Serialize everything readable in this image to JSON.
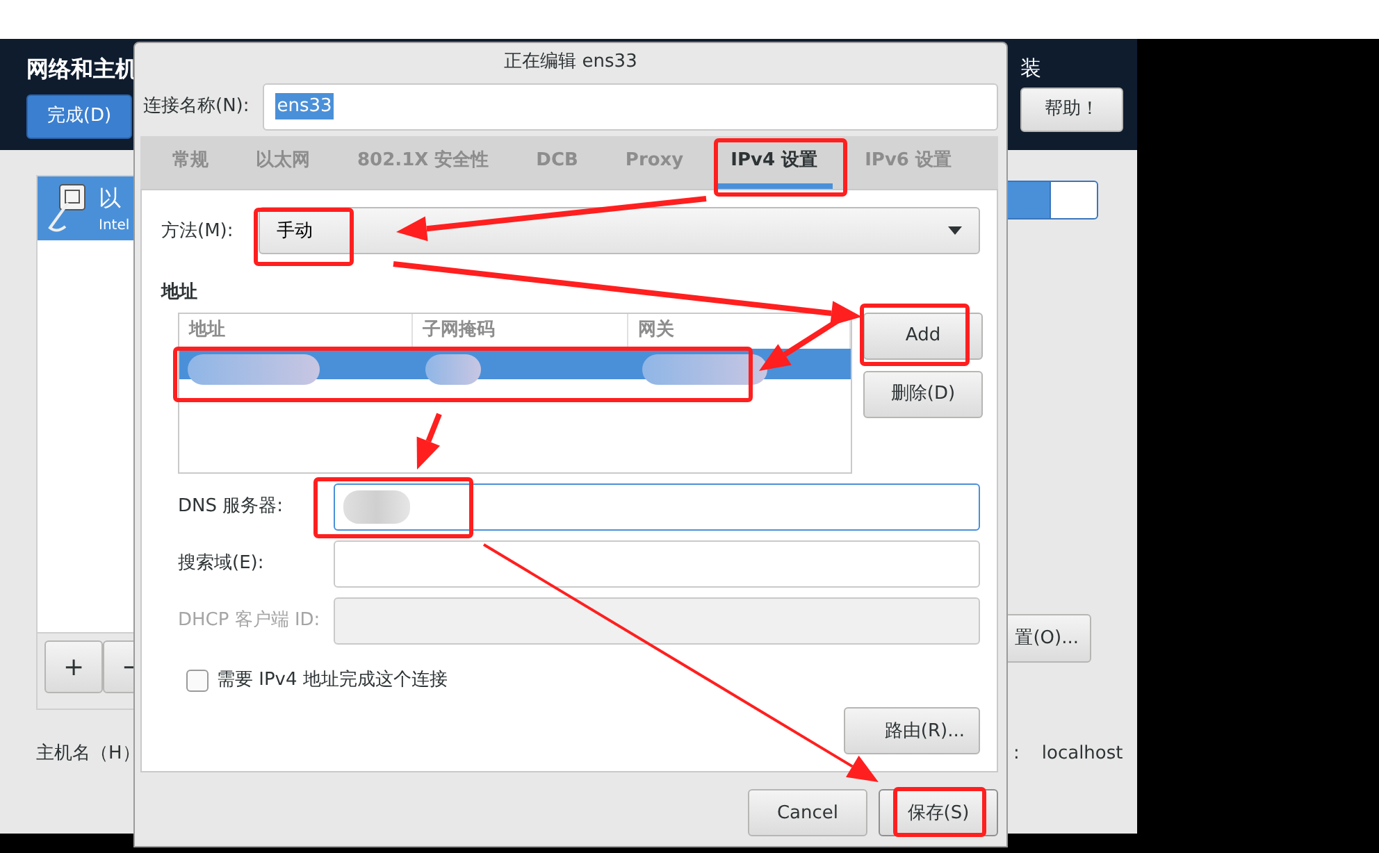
{
  "background_app": {
    "title": "网络和主机",
    "done_button": "完成(D)",
    "header_text": "装",
    "help_button": "帮助！",
    "connections": [
      {
        "name": "以",
        "subtitle": "Intel",
        "selected": true
      }
    ],
    "add_button": "+",
    "remove_button": "−",
    "toggle": {
      "on": true
    },
    "configure_button": "置(O)...",
    "hostname_label": "主机名（H）",
    "hostname_colon": ":",
    "hostname_value": "localhost"
  },
  "dialog": {
    "title": "正在编辑 ens33",
    "connection_name_label": "连接名称(N):",
    "connection_name": "ens33",
    "tabs": [
      {
        "label": "常规",
        "selected": false
      },
      {
        "label": "以太网",
        "selected": false
      },
      {
        "label": "802.1X 安全性",
        "selected": false
      },
      {
        "label": "DCB",
        "selected": false
      },
      {
        "label": "Proxy",
        "selected": false
      },
      {
        "label": "IPv4 设置",
        "selected": true
      },
      {
        "label": "IPv6 设置",
        "selected": false
      }
    ],
    "method_label": "方法(M):",
    "method": "手动",
    "address_heading": "地址",
    "address_columns": [
      "地址",
      "子网掩码",
      "网关"
    ],
    "address_rows": [
      {
        "selected": true,
        "redacted": true
      }
    ],
    "add_button": "Add",
    "delete_button": "删除(D)",
    "fields": [
      {
        "label": "DNS 服务器:",
        "focused": true,
        "disabled": false,
        "redacted": true
      },
      {
        "label": "搜索域(E):",
        "focused": false,
        "disabled": false,
        "redacted": false
      },
      {
        "label": "DHCP 客户端 ID:",
        "focused": false,
        "disabled": true,
        "redacted": false
      }
    ],
    "checkbox": {
      "label": "需要 IPv4 地址完成这个连接",
      "checked": false
    },
    "routes_button": "路由(R)...",
    "buttons": [
      {
        "label": "Cancel",
        "kind": "cancel"
      },
      {
        "label": "保存(S)",
        "kind": "save"
      }
    ]
  }
}
